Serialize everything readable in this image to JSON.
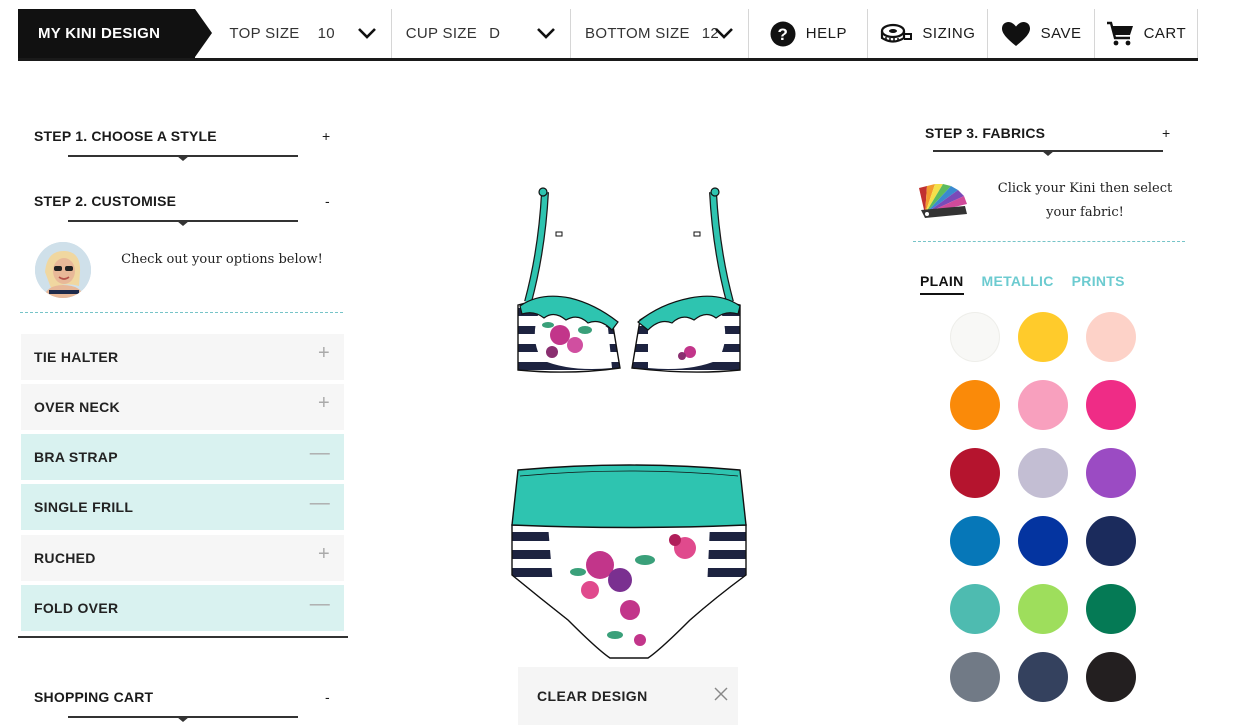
{
  "header": {
    "brand": "MY KINI DESIGN",
    "top_size": {
      "label": "TOP SIZE",
      "value": "10"
    },
    "cup_size": {
      "label": "CUP SIZE",
      "value": "D"
    },
    "bottom_size": {
      "label": "BOTTOM SIZE",
      "value": "12"
    },
    "help": "HELP",
    "sizing": "SIZING",
    "save": "SAVE",
    "cart": "CART"
  },
  "left": {
    "step1": {
      "label": "STEP 1.  CHOOSE A STYLE",
      "toggle": "+"
    },
    "step2": {
      "label": "STEP 2.  CUSTOMISE",
      "toggle": "-"
    },
    "note": "Check out your options below!",
    "options": [
      {
        "label": "TIE HALTER",
        "control": "+",
        "state": "off"
      },
      {
        "label": "OVER NECK",
        "control": "+",
        "state": "off"
      },
      {
        "label": "BRA STRAP",
        "control": "—",
        "state": "on"
      },
      {
        "label": "SINGLE FRILL",
        "control": "—",
        "state": "on"
      },
      {
        "label": "RUCHED",
        "control": "+",
        "state": "off"
      },
      {
        "label": "FOLD OVER",
        "control": "—",
        "state": "on"
      }
    ],
    "shopping_cart": {
      "label": "SHOPPING CART",
      "toggle": "-"
    }
  },
  "center": {
    "clear_design": "CLEAR DESIGN"
  },
  "right": {
    "step3": {
      "label": "STEP 3. FABRICS",
      "toggle": "+"
    },
    "note_line1": "Click your Kini then select",
    "note_line2": "your fabric!",
    "tabs": [
      "PLAIN",
      "METALLIC",
      "PRINTS"
    ],
    "active_tab": "PLAIN",
    "swatches": [
      "#f8f8f6",
      "#ffcb2b",
      "#fdd2c8",
      "#fa8a09",
      "#f8a0be",
      "#ef2c86",
      "#b5142e",
      "#c3bed3",
      "#9b4bc3",
      "#0677b8",
      "#0434a0",
      "#1b2b5c",
      "#4ebbb0",
      "#9ede5c",
      "#057a55",
      "#717a86",
      "#34415e",
      "#231f20"
    ]
  },
  "colors": {
    "accent_teal": "#2ec4b0",
    "selected_option_bg": "#d9f2f0",
    "tab_inactive": "#6ccbd0"
  }
}
